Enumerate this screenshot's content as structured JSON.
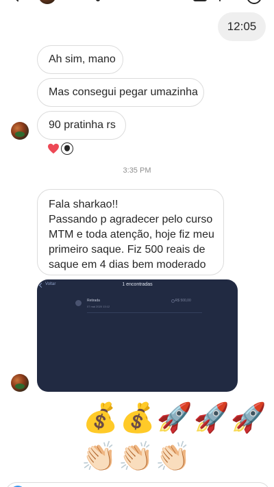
{
  "sent": {
    "time_message": "12:05"
  },
  "messages": [
    {
      "text": "Ah sim, mano"
    },
    {
      "text": "Mas consegui pegar umazinha"
    },
    {
      "text": "90 pratinha rs"
    }
  ],
  "reactions": {
    "heart": "❤️",
    "reactor_icon": "user-avatar-icon"
  },
  "timestamp": "3:35 PM",
  "long_message": {
    "lines": [
      "Fala sharkao!!",
      "Passando p agradecer pelo curso",
      "MTM e toda atenção, hoje fiz meu",
      "primeiro saque. Fiz 500 reais de",
      "saque em 4 dias bem moderado"
    ]
  },
  "media": {
    "back_label": "Voltar",
    "title": "1 encontradas",
    "row_label": "Retirada",
    "row_date": "07 mai 2020 13:12",
    "row_amount": "-R$ 500,00"
  },
  "emojis": {
    "row1": [
      "💰",
      "💰",
      "🚀",
      "🚀",
      "🚀"
    ],
    "row2": [
      "👏🏻",
      "👏🏻",
      "👏🏻"
    ]
  },
  "colors": {
    "bubble_border": "#dbdbdb",
    "sent_bubble": "#efefef",
    "media_bg": "#212a42",
    "timestamp": "#8e8e8e"
  }
}
